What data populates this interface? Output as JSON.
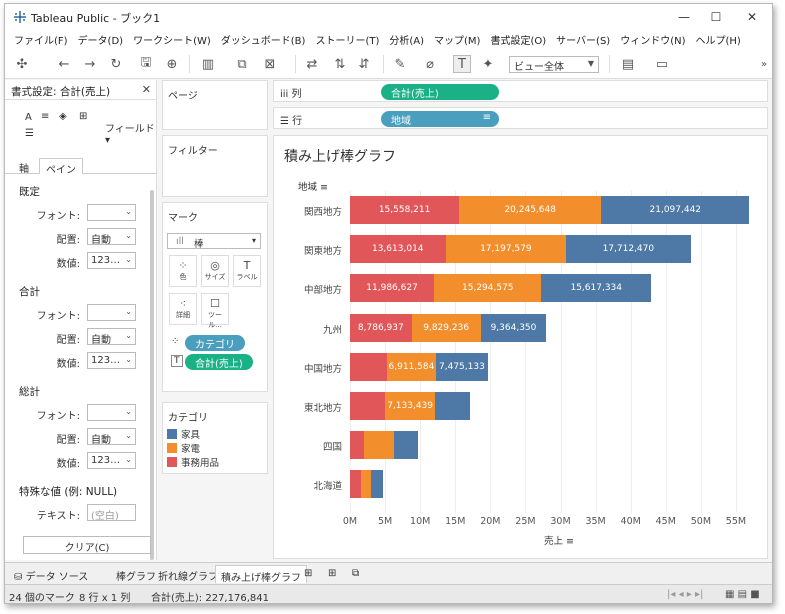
{
  "window": {
    "title": "Tableau Public - ブック1"
  },
  "menu": [
    "ファイル(F)",
    "データ(D)",
    "ワークシート(W)",
    "ダッシュボード(B)",
    "ストーリー(T)",
    "分析(A)",
    "マップ(M)",
    "書式設定(O)",
    "サーバー(S)",
    "ウィンドウ(N)",
    "ヘルプ(H)"
  ],
  "toolbar": {
    "view_select": "ビュー全体"
  },
  "format_panel": {
    "title": "書式設定: 合計(売上)",
    "field_label": "フィールド",
    "tabs": [
      "軸",
      "ペイン"
    ],
    "sections": [
      {
        "name": "既定",
        "rows": [
          {
            "label": "フォント:",
            "value": ""
          },
          {
            "label": "配置:",
            "value": "自動"
          },
          {
            "label": "数値:",
            "value": "123…"
          }
        ]
      },
      {
        "name": "合計",
        "rows": [
          {
            "label": "フォント:",
            "value": ""
          },
          {
            "label": "配置:",
            "value": "自動"
          },
          {
            "label": "数値:",
            "value": "123…"
          }
        ]
      },
      {
        "name": "総計",
        "rows": [
          {
            "label": "フォント:",
            "value": ""
          },
          {
            "label": "配置:",
            "value": "自動"
          },
          {
            "label": "数値:",
            "value": "123…"
          }
        ]
      }
    ],
    "special_values": "特殊な値 (例: NULL)",
    "text_label": "テキスト:",
    "text_placeholder": "(空白)",
    "clear_button": "クリア(C)"
  },
  "cards": {
    "pages": "ページ",
    "filters": "フィルター",
    "marks": "マーク",
    "mark_type": "棒",
    "mark_buttons": [
      "色",
      "サイズ",
      "ラベル",
      "詳細",
      "ツール..."
    ],
    "mark_pills": [
      "カテゴリ",
      "合計(売上)"
    ],
    "legend_title": "カテゴリ",
    "legend": [
      {
        "name": "家具",
        "color": "#4e79a7"
      },
      {
        "name": "家電",
        "color": "#f28e2b"
      },
      {
        "name": "事務用品",
        "color": "#e15759"
      }
    ]
  },
  "shelves": {
    "columns_label": "列",
    "columns_pill": "合計(売上)",
    "rows_label": "行",
    "rows_pill": "地域"
  },
  "chart_data": {
    "type": "bar",
    "title": "積み上げ棒グラフ",
    "row_header": "地域",
    "xlabel": "売上",
    "categories": [
      "関西地方",
      "関東地方",
      "中部地方",
      "九州",
      "中国地方",
      "東北地方",
      "四国",
      "北海道"
    ],
    "series": [
      {
        "name": "事務用品",
        "color": "#e15759",
        "values": [
          15558211,
          13613014,
          11986627,
          8786937,
          5300000,
          5000000,
          2000000,
          1500000
        ],
        "labels": [
          "15,558,211",
          "13,613,014",
          "11,986,627",
          "8,786,937",
          "",
          "",
          "",
          ""
        ]
      },
      {
        "name": "家電",
        "color": "#f28e2b",
        "values": [
          20245648,
          17197579,
          15294575,
          9829236,
          6911584,
          7133439,
          4200000,
          1500000
        ],
        "labels": [
          "20,245,648",
          "17,197,579",
          "15,294,575",
          "9,829,236",
          "6,911,584",
          "7,133,439",
          "",
          ""
        ]
      },
      {
        "name": "家具",
        "color": "#4e79a7",
        "values": [
          21097442,
          17712470,
          15617334,
          9364350,
          7475133,
          5000000,
          3500000,
          1700000
        ],
        "labels": [
          "21,097,442",
          "17,712,470",
          "15,617,334",
          "9,364,350",
          "7,475,133",
          "",
          "",
          ""
        ]
      }
    ],
    "xlim": [
      0,
      57000000
    ],
    "ticks": [
      "0M",
      "5M",
      "10M",
      "15M",
      "20M",
      "25M",
      "30M",
      "35M",
      "40M",
      "45M",
      "50M",
      "55M"
    ],
    "tick_values": [
      0,
      5000000,
      10000000,
      15000000,
      20000000,
      25000000,
      30000000,
      35000000,
      40000000,
      45000000,
      50000000,
      55000000
    ]
  },
  "sheet_tabs": [
    "データ ソース",
    "棒グラフ",
    "折れ線グラフ",
    "積み上げ棒グラフ"
  ],
  "status": {
    "marks": "24 個のマーク",
    "rows_cols": "8 行 x 1 列",
    "sum": "合計(売上): 227,176,841"
  }
}
